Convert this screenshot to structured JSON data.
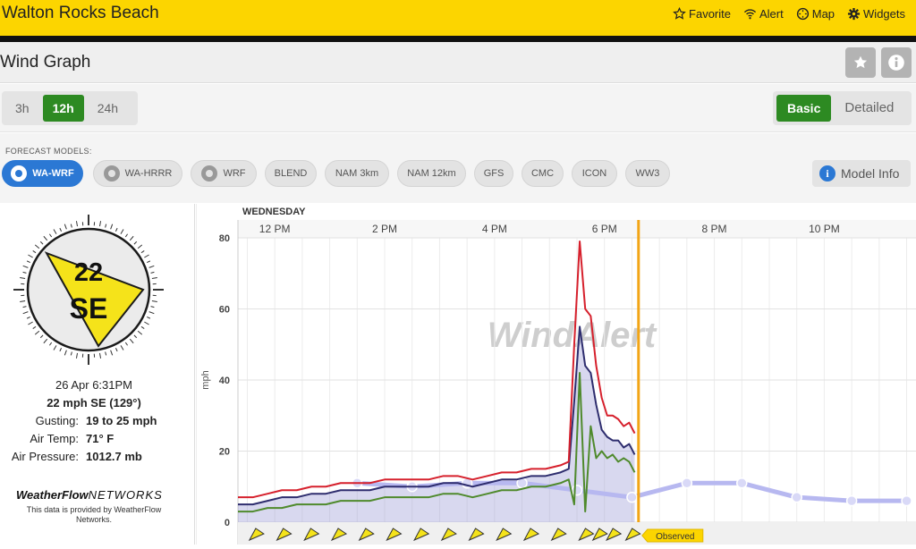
{
  "app": {
    "location": "Walton Rocks Beach",
    "nav": [
      {
        "icon": "star-outline-icon",
        "label": "Favorite"
      },
      {
        "icon": "wifi-signal-icon",
        "label": "Alert"
      },
      {
        "icon": "compass-map-icon",
        "label": "Map"
      },
      {
        "icon": "gear-widgets-icon",
        "label": "Widgets"
      }
    ]
  },
  "page": {
    "title": "Wind Graph"
  },
  "time_range": {
    "options": [
      "3h",
      "12h",
      "24h"
    ],
    "selected": "12h"
  },
  "view_mode": {
    "options": [
      "Basic",
      "Detailed"
    ],
    "selected": "Basic"
  },
  "models": {
    "label": "FORECAST MODELS:",
    "items": [
      {
        "label": "WA-WRF",
        "active": true,
        "gear": true
      },
      {
        "label": "WA-HRRR",
        "active": false,
        "gear": true
      },
      {
        "label": "WRF",
        "active": false,
        "gear": true
      },
      {
        "label": "BLEND",
        "active": false,
        "gear": false
      },
      {
        "label": "NAM 3km",
        "active": false,
        "gear": false
      },
      {
        "label": "NAM 12km",
        "active": false,
        "gear": false
      },
      {
        "label": "GFS",
        "active": false,
        "gear": false
      },
      {
        "label": "CMC",
        "active": false,
        "gear": false
      },
      {
        "label": "ICON",
        "active": false,
        "gear": false
      },
      {
        "label": "WW3",
        "active": false,
        "gear": false
      }
    ],
    "info_label": "Model Info"
  },
  "current": {
    "speed": "22",
    "direction": "SE",
    "direction_degrees": 129,
    "timestamp": "26 Apr 6:31PM",
    "summary": "22 mph SE (129°)",
    "rows": [
      {
        "label": "Gusting:",
        "value": "19 to 25 mph"
      },
      {
        "label": "Air Temp:",
        "value": "71° F"
      },
      {
        "label": "Air Pressure:",
        "value": "1012.7 mb"
      }
    ],
    "brand_main": "WeatherFlow",
    "brand_sub": "NETWORKS",
    "provided_line1": "This data is provided by WeatherFlow",
    "provided_line2": "Networks."
  },
  "colors": {
    "gust": "#d6202c",
    "avg": "#2e2d6e",
    "lull": "#4f8a2c",
    "forecast": "#b7b8f0",
    "now_line": "#f2a516",
    "brand_yellow": "#fcd500",
    "active_green": "#2d8a22",
    "active_blue": "#2b78d4"
  },
  "chart_data": {
    "type": "line",
    "day_label": "WEDNESDAY",
    "watermark": "WindAlert",
    "ylabel": "mph",
    "ylim": [
      0,
      80
    ],
    "yticks": [
      0,
      20,
      40,
      60,
      80
    ],
    "x_hours_range": [
      11.33,
      23.67
    ],
    "xticks": [
      {
        "hour": 12,
        "label": "12 PM"
      },
      {
        "hour": 14,
        "label": "2 PM"
      },
      {
        "hour": 16,
        "label": "4 PM"
      },
      {
        "hour": 18,
        "label": "6 PM"
      },
      {
        "hour": 20,
        "label": "8 PM"
      },
      {
        "hour": 22,
        "label": "10 PM"
      }
    ],
    "now_hour": 18.62,
    "now_label": "Observed",
    "observed_hours": [
      11.33,
      11.6,
      11.87,
      12.13,
      12.4,
      12.67,
      12.93,
      13.2,
      13.47,
      13.73,
      14.0,
      14.27,
      14.53,
      14.8,
      15.07,
      15.33,
      15.6,
      15.87,
      16.13,
      16.4,
      16.67,
      16.93,
      17.2,
      17.35,
      17.45,
      17.55,
      17.65,
      17.75,
      17.85,
      17.95,
      18.05,
      18.15,
      18.25,
      18.35,
      18.45,
      18.55
    ],
    "series": [
      {
        "name": "Gust",
        "values": [
          7,
          7,
          8,
          9,
          9,
          10,
          10,
          11,
          11,
          11,
          12,
          12,
          12,
          12,
          13,
          13,
          12,
          13,
          14,
          14,
          15,
          15,
          16,
          17,
          50,
          79,
          60,
          58,
          44,
          35,
          30,
          30,
          29,
          27,
          28,
          25
        ]
      },
      {
        "name": "Average",
        "values": [
          5,
          5,
          6,
          7,
          7,
          8,
          8,
          9,
          9,
          9,
          10,
          10,
          10,
          10,
          11,
          11,
          10,
          11,
          12,
          12,
          13,
          13,
          14,
          15,
          34,
          55,
          44,
          42,
          33,
          26,
          24,
          23,
          23,
          21,
          22,
          19
        ]
      },
      {
        "name": "Lull",
        "values": [
          3,
          3,
          4,
          4,
          5,
          5,
          5,
          6,
          6,
          6,
          7,
          7,
          7,
          7,
          8,
          8,
          7,
          8,
          9,
          9,
          10,
          10,
          11,
          12,
          5,
          42,
          3,
          27,
          18,
          20,
          18,
          19,
          17,
          18,
          17,
          14
        ]
      },
      {
        "name": "Forecast",
        "hours": [
          13.5,
          14.5,
          15.5,
          16.5,
          17.5,
          18.5,
          19.5,
          20.5,
          21.5,
          22.5,
          23.5
        ],
        "values": [
          11,
          10,
          11,
          11,
          9,
          7,
          11,
          11,
          7,
          6,
          6
        ]
      }
    ],
    "arrow_hours": [
      11.67,
      12.17,
      12.67,
      13.17,
      13.67,
      14.17,
      14.67,
      15.17,
      15.67,
      16.17,
      16.67,
      17.17,
      17.67,
      17.92,
      18.17,
      18.52
    ]
  }
}
